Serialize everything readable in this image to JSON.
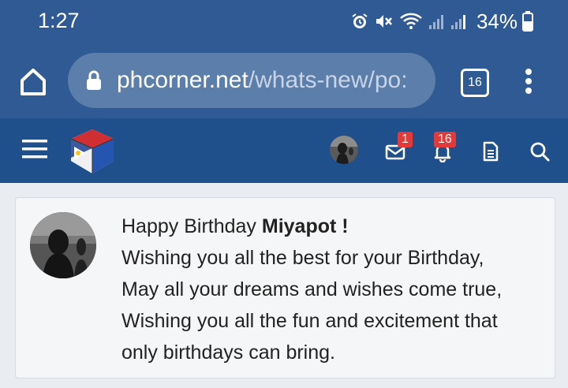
{
  "status_bar": {
    "time": "1:27",
    "battery": "34%"
  },
  "browser": {
    "url_domain": "phcorner.net",
    "url_path": "/whats-new/po:",
    "tab_count": "16"
  },
  "header": {
    "inbox_badge": "1",
    "alerts_badge": "16"
  },
  "post": {
    "greeting_prefix": "Happy Birthday ",
    "name": "Miyapot !",
    "lines": [
      "Wishing you all the best for your Birthday,",
      "May all your dreams and wishes come true,",
      "Wishing you all the fun and excitement that",
      "only birthdays can bring."
    ]
  },
  "colors": {
    "status_bar": "#2f5a94",
    "site_header": "#20508c",
    "badge": "#e03a3a"
  }
}
